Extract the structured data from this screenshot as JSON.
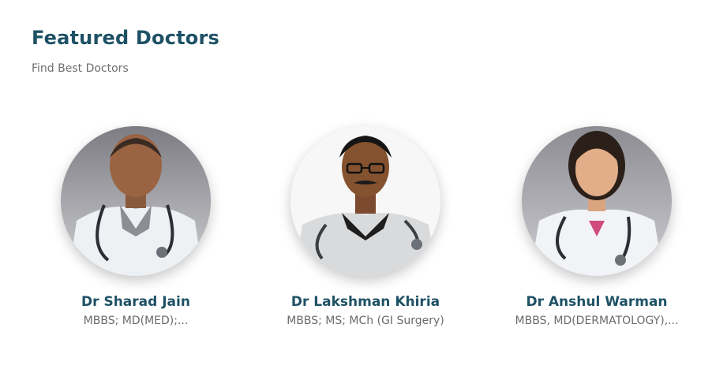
{
  "section": {
    "title": "Featured Doctors",
    "subtitle": "Find Best Doctors"
  },
  "doctors": [
    {
      "name": "Dr Sharad Jain",
      "qualification": "MBBS; MD(MED);..."
    },
    {
      "name": "Dr Lakshman Khiria",
      "qualification": "MBBS; MS; MCh (GI Surgery)"
    },
    {
      "name": "Dr Anshul Warman",
      "qualification": "MBBS, MD(DERMATOLOGY),..."
    }
  ]
}
